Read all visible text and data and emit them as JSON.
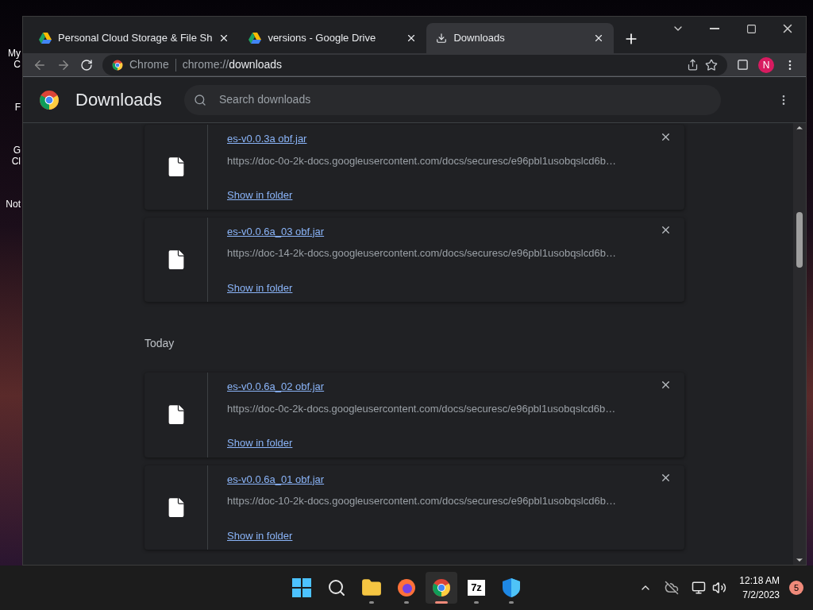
{
  "desktop_icons": [
    {
      "lines": [
        "My C"
      ]
    },
    {
      "lines": [
        "F"
      ]
    },
    {
      "lines": [
        "G",
        "Cl"
      ]
    },
    {
      "lines": [
        "Not"
      ]
    }
  ],
  "tabs": [
    {
      "title": "Personal Cloud Storage & File Sh",
      "kind": "site",
      "selected": false
    },
    {
      "title": "versions - Google Drive",
      "kind": "site",
      "selected": false
    },
    {
      "title": "Downloads",
      "kind": "internal",
      "selected": true
    }
  ],
  "address_bar": {
    "site_label": "Chrome",
    "url": "chrome://**downloads**"
  },
  "profile": {
    "initial": "N"
  },
  "page": {
    "title": "Downloads",
    "search": {
      "placeholder": "Search downloads"
    }
  },
  "sections": [
    {
      "items": [
        {
          "name": "es-v0.0.3a obf.jar",
          "url": "https://doc-0o-2k-docs.googleusercontent.com/docs/securesc/e96pbl1usobqslcd6b…",
          "action": "Show in folder"
        },
        {
          "name": "es-v0.0.6a_03 obf.jar",
          "url": "https://doc-14-2k-docs.googleusercontent.com/docs/securesc/e96pbl1usobqslcd6b…",
          "action": "Show in folder"
        }
      ]
    },
    {
      "heading": "Today",
      "items": [
        {
          "name": "es-v0.0.6a_02 obf.jar",
          "url": "https://doc-0c-2k-docs.googleusercontent.com/docs/securesc/e96pbl1usobqslcd6b…",
          "action": "Show in folder"
        },
        {
          "name": "es-v0.0.6a_01 obf.jar",
          "url": "https://doc-10-2k-docs.googleusercontent.com/docs/securesc/e96pbl1usobqslcd6b…",
          "action": "Show in folder"
        }
      ]
    }
  ],
  "taskbar": {
    "apps": [
      {
        "kind": "start",
        "selected": false
      },
      {
        "kind": "search",
        "selected": false
      },
      {
        "kind": "folder",
        "selected": false
      },
      {
        "kind": "firefox",
        "selected": false
      },
      {
        "kind": "chrome",
        "selected": true
      },
      {
        "kind": "archive",
        "label": "7z",
        "selected": false
      },
      {
        "kind": "shield",
        "selected": false
      }
    ],
    "time": "12:18 AM",
    "date": "7/2/2023",
    "notifications": "5"
  }
}
